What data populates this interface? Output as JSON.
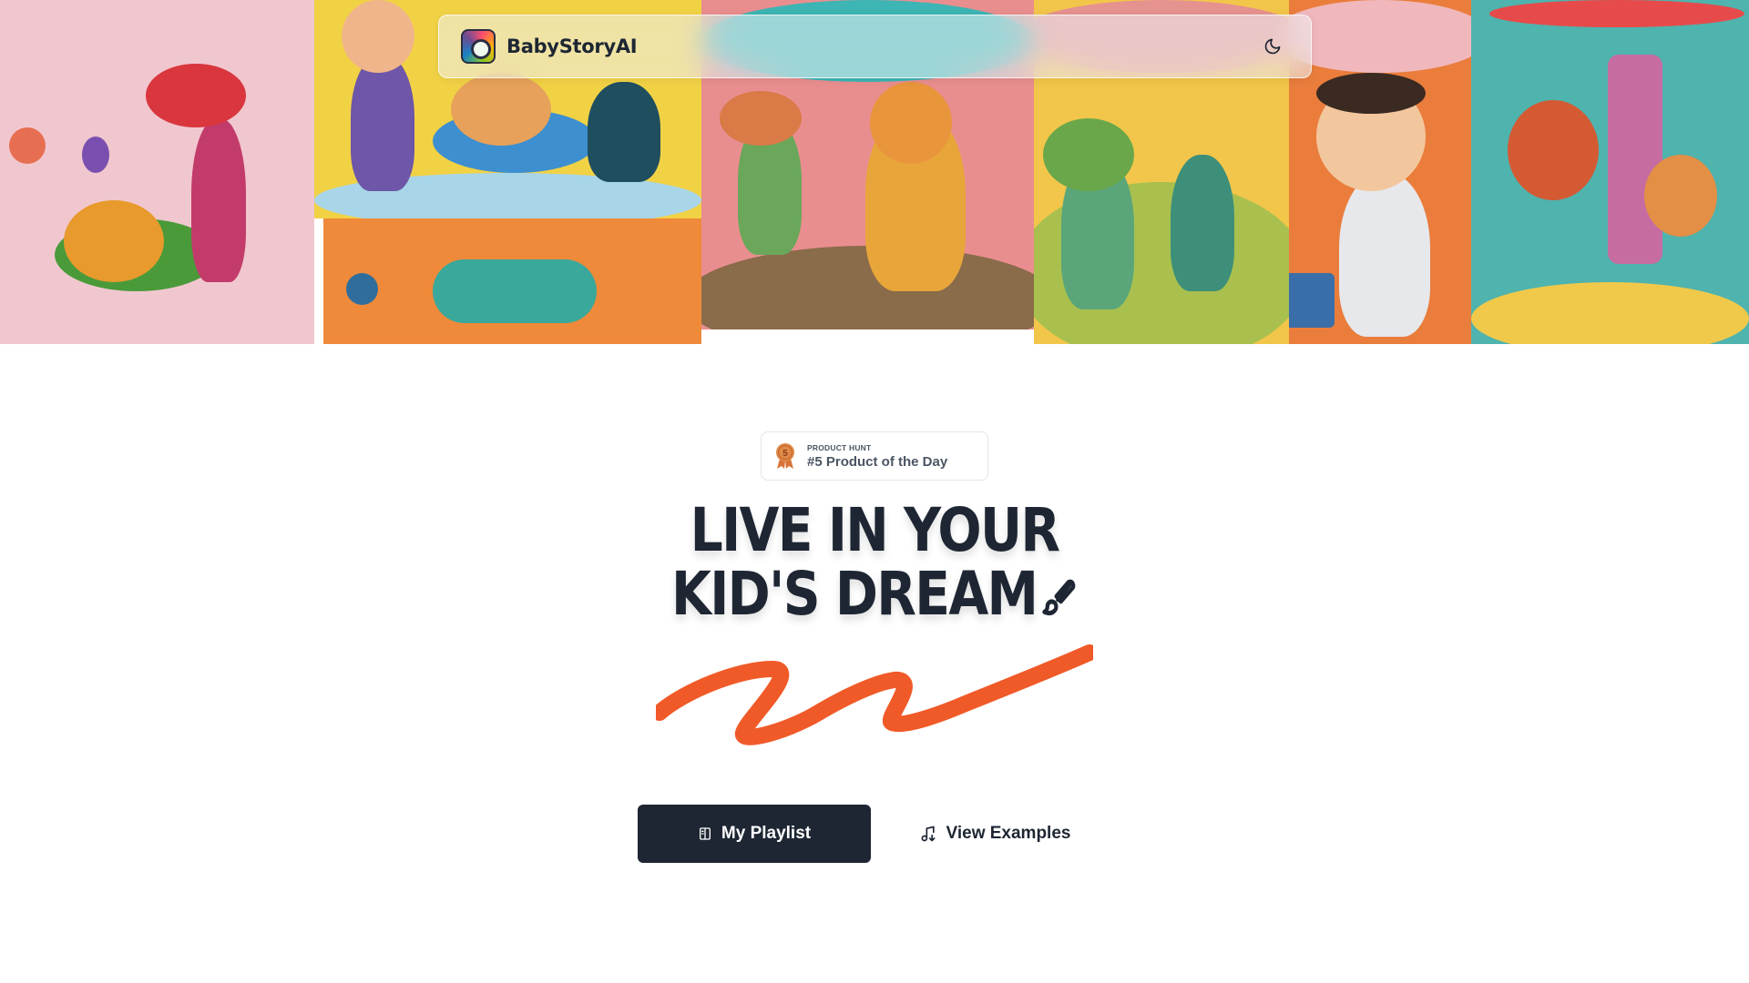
{
  "navbar": {
    "brand": "BabyStoryAI",
    "logo_icon": "rainbow-app-logo",
    "theme_toggle_icon": "moon-icon"
  },
  "hero": {
    "collage_alt": "illustrated cartoon characters collage"
  },
  "badge": {
    "kicker": "PRODUCT HUNT",
    "title": "#5 Product of the Day",
    "medal_number": "5",
    "medal_icon": "award-medal-icon"
  },
  "headline": {
    "line1": "Live in your",
    "line2": "kid's dream",
    "icon": "paintbrush-icon"
  },
  "actions": {
    "primary_label": "My Playlist",
    "primary_icon": "book-icon",
    "secondary_label": "View Examples",
    "secondary_icon": "music-icon"
  },
  "colors": {
    "primary_dark": "#1e2633",
    "accent_orange": "#f05a28",
    "badge_text": "#4b5563"
  }
}
